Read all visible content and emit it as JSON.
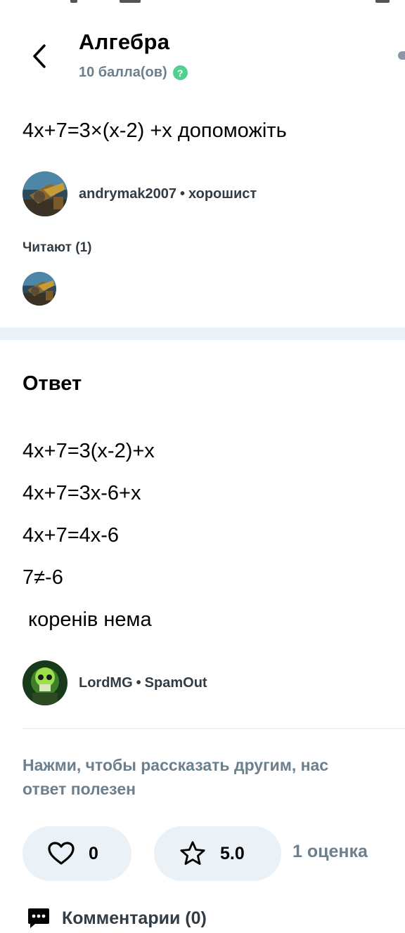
{
  "header": {
    "subject": "Алгебра",
    "points": "10 балла(ов)",
    "help_symbol": "?"
  },
  "question": {
    "text": "4x+7=3×(x-2) +x допоможіть",
    "author": "andrymak2007",
    "author_rank": "хорошист"
  },
  "readers": {
    "label": "Читают (1)"
  },
  "answer": {
    "title": "Ответ",
    "lines": [
      "4x+7=3(x-2)+x",
      "4x+7=3x-6+x",
      "4x+7=4x-6",
      "7≠-6",
      " коренів нема"
    ],
    "author": "LordMG",
    "author_rank": "SpamOut"
  },
  "share": {
    "text_line1": "Нажми, чтобы рассказать другим, нас",
    "text_line2": "ответ полезен"
  },
  "actions": {
    "likes": "0",
    "rating": "5.0",
    "rating_count": "1 оценка"
  },
  "comments": {
    "label": "Комментарии (0)"
  },
  "colors": {
    "accent_green": "#4fd190",
    "muted_text": "#6b7f8d",
    "band": "#ebf2f7"
  },
  "icons": [
    "back-chevron-icon",
    "help-icon",
    "heart-icon",
    "star-icon",
    "comment-icon"
  ]
}
